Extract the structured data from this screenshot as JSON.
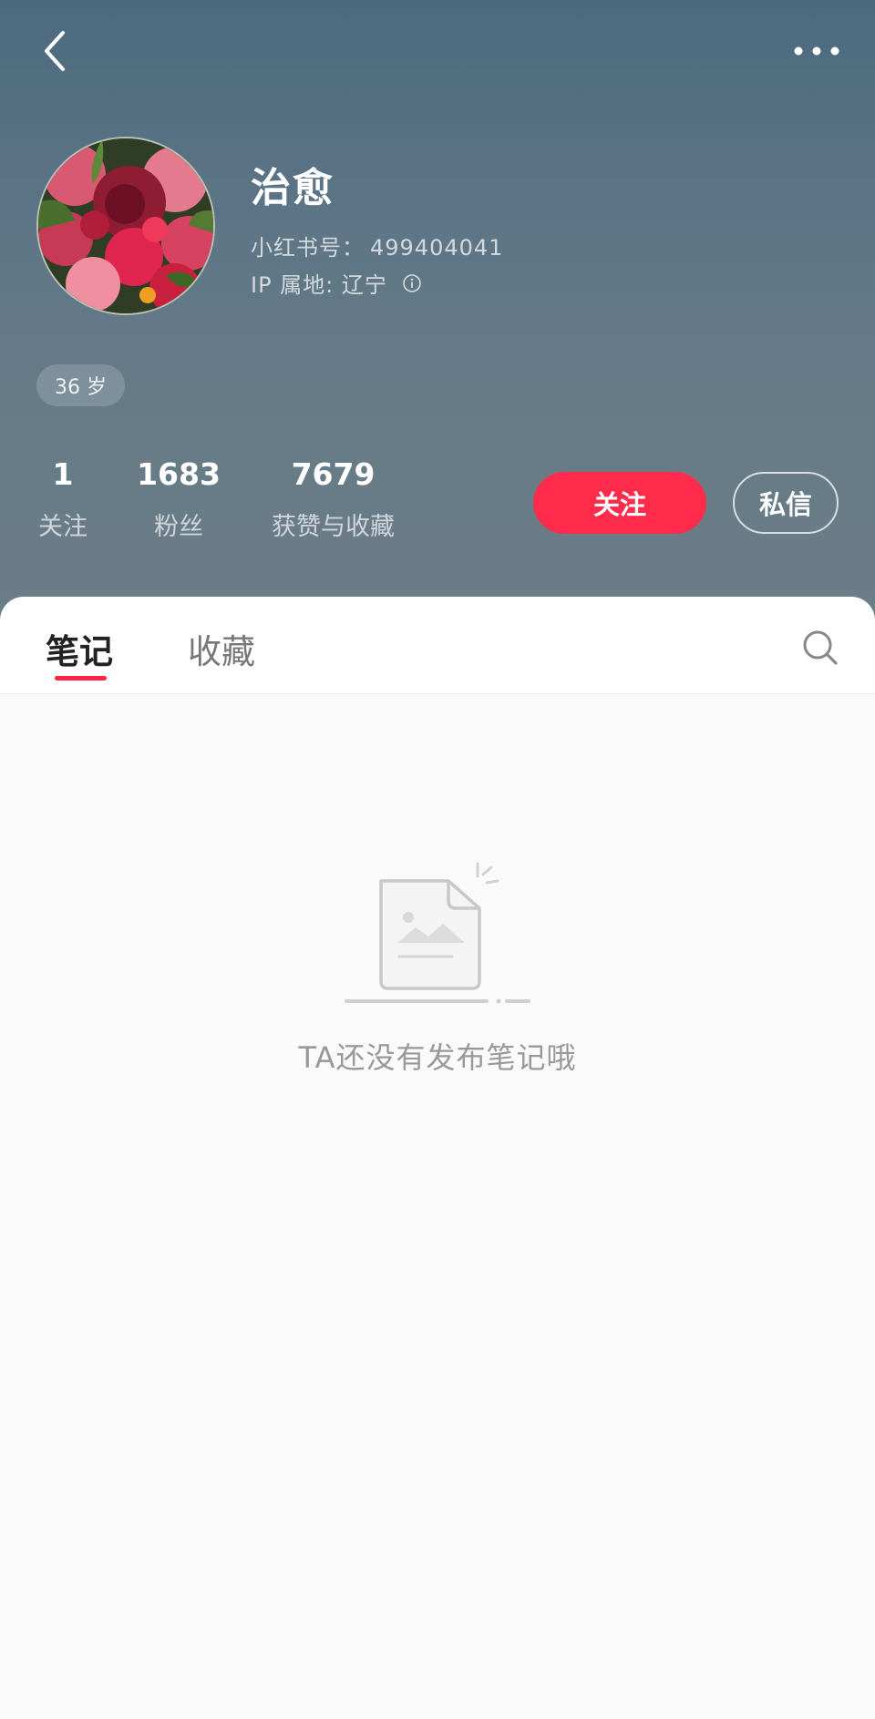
{
  "header": {
    "back_icon": "chevron-left-icon",
    "more_icon": "more-dots-icon"
  },
  "profile": {
    "nickname": "治愈",
    "id_label": "小红书号：",
    "id_value": "499404041",
    "ip_location": "IP 属地: 辽宁",
    "info_icon": "info-icon",
    "age_tag": "36 岁"
  },
  "stats": {
    "following_count": "1",
    "following_label": "关注",
    "fans_count": "1683",
    "fans_label": "粉丝",
    "likes_count": "7679",
    "likes_label": "获赞与收藏"
  },
  "actions": {
    "follow_label": "关注",
    "message_label": "私信",
    "follow_color": "#fe2c4a"
  },
  "tabs": [
    {
      "label": "笔记",
      "active": true
    },
    {
      "label": "收藏",
      "active": false
    }
  ],
  "search_icon": "search-icon",
  "empty_state": {
    "illustration": "empty-document-icon",
    "message": "TA还没有发布笔记哦"
  },
  "colors": {
    "header_bg_top": "#4c6a7e",
    "header_bg_bottom": "#6b7d88",
    "accent": "#ff2442",
    "page_bg": "#fafafa"
  }
}
